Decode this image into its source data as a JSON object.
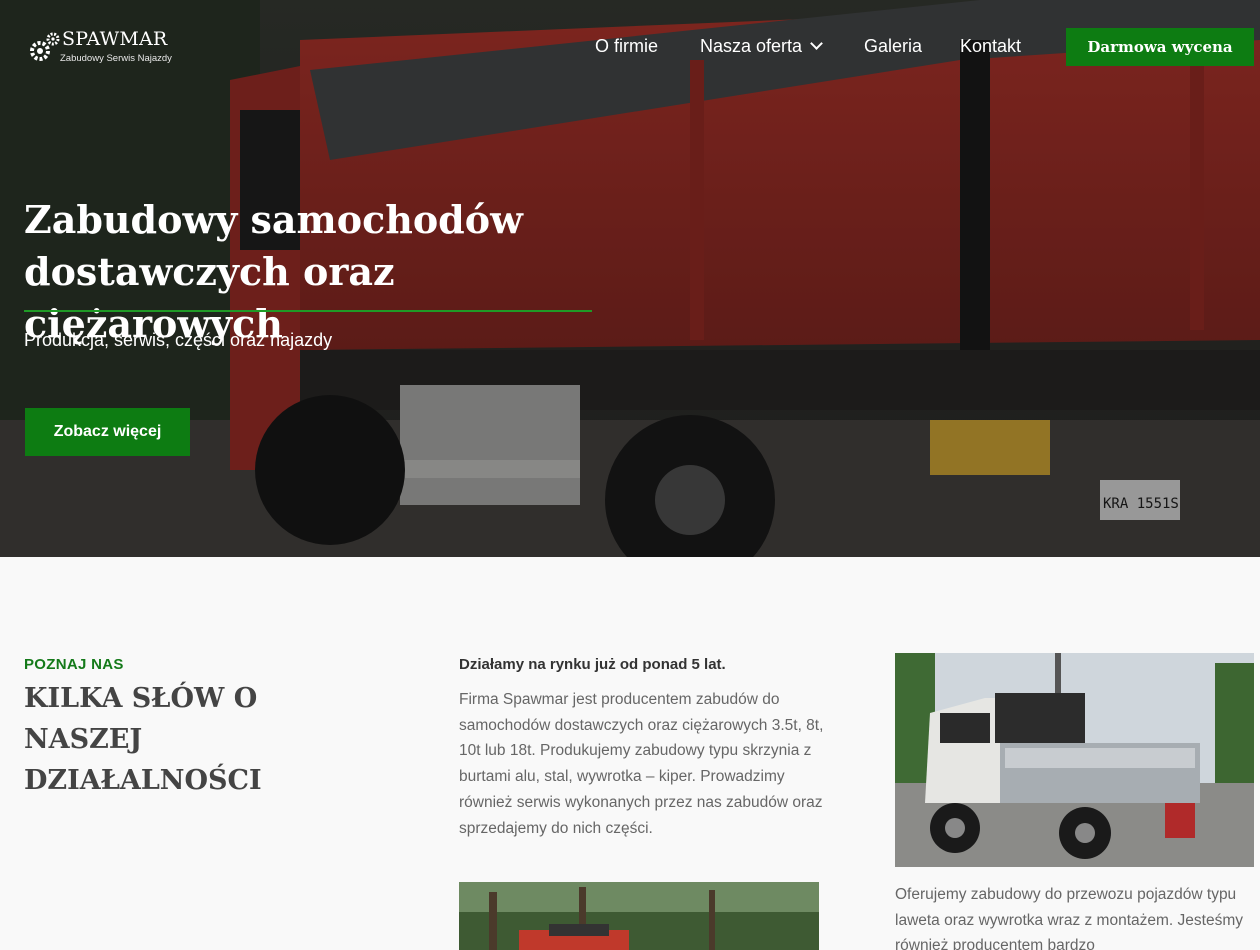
{
  "brand": {
    "name": "SPAWMAR",
    "tagline": "Zabudowy Serwis Najazdy",
    "logo_icon": "gears-icon"
  },
  "nav": {
    "items": [
      {
        "label": "O firmie"
      },
      {
        "label": "Nasza oferta",
        "icon": "chevron-down-icon"
      },
      {
        "label": "Galeria"
      },
      {
        "label": "Kontakt"
      }
    ],
    "cta_label": "Darmowa wycena"
  },
  "hero": {
    "title": "Zabudowy samochodów dostawczych oraz ciężarowych",
    "subtitle": "Produkcja, serwis, części oraz najazdy",
    "button_label": "Zobacz więcej",
    "plate_text": "KRA 1551S"
  },
  "about": {
    "eyebrow": "POZNAJ NAS",
    "title": "KILKA SŁÓW O NASZEJ DZIAŁALNOŚCI",
    "lead": "Działamy na rynku już od ponad 5 lat.",
    "body": "Firma Spawmar jest producentem zabudów do samochodów dostawczych oraz ciężarowych 3.5t, 8t, 10t lub 18t. Produkujemy zabudowy typu skrzynia z burtami alu, stal, wywrotka – kiper. Prowadzimy również serwis wykonanych przez nas zabudów oraz sprzedajemy do nich części.",
    "right_text": "Oferujemy zabudowy do przewozu pojazdów typu laweta oraz wywrotka wraz z montażem. Jesteśmy również producentem bardzo"
  },
  "colors": {
    "accent_green": "#0d7c12",
    "eyebrow_green": "#157a1a",
    "truck_red": "#b3352e"
  }
}
